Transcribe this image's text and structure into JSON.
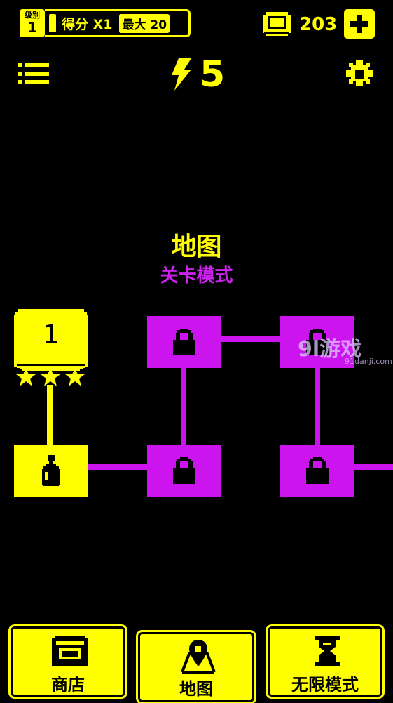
{
  "hud": {
    "level_label": "级别",
    "level_value": "1",
    "score_label": "得分 X1",
    "max_label": "最大 20",
    "coins": "203",
    "energy": "5"
  },
  "title": {
    "main": "地图",
    "subtitle": "关卡模式"
  },
  "levels": {
    "first_level_number": "1",
    "stars_earned": 3,
    "stars_total": 3
  },
  "watermark": {
    "logo": "9l游戏",
    "domain": "91danji.com"
  },
  "nav": {
    "shop": "商店",
    "map": "地图",
    "endless": "无限模式"
  },
  "colors": {
    "accent": "#ffff00",
    "locked": "#cc14ee",
    "background": "#000000"
  }
}
